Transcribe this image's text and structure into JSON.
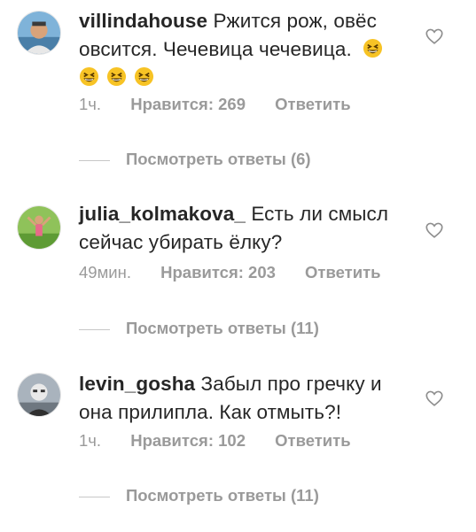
{
  "comments": [
    {
      "username": "villindahouse",
      "text": "Ржится рож, овёс овсится. Чечевица чечевица.",
      "emojis": [
        "grinning-squinting-face",
        "grinning-squinting-face",
        "grinning-squinting-face",
        "grinning-squinting-face"
      ],
      "time": "1ч.",
      "likes": "Нравится: 269",
      "reply": "Ответить",
      "view_replies": "Посмотреть ответы (6)"
    },
    {
      "username": "julia_kolmakova_",
      "text": "Есть ли смысл сейчас убирать ёлку?",
      "time": "49мин.",
      "likes": "Нравится: 203",
      "reply": "Ответить",
      "view_replies": "Посмотреть ответы (11)"
    },
    {
      "username": "levin_gosha",
      "text": "Забыл про гречку и она прилипла. Как отмыть?!",
      "time": "1ч.",
      "likes": "Нравится: 102",
      "reply": "Ответить",
      "view_replies": "Посмотреть ответы (11)"
    }
  ],
  "colors": {
    "text": "#262626",
    "muted": "#9a9a9a",
    "divider": "#c7c7c7",
    "emoji": "#f7c325"
  },
  "icons": {
    "like": "heart-outline-icon",
    "emoji": "grinning-squinting-face"
  }
}
